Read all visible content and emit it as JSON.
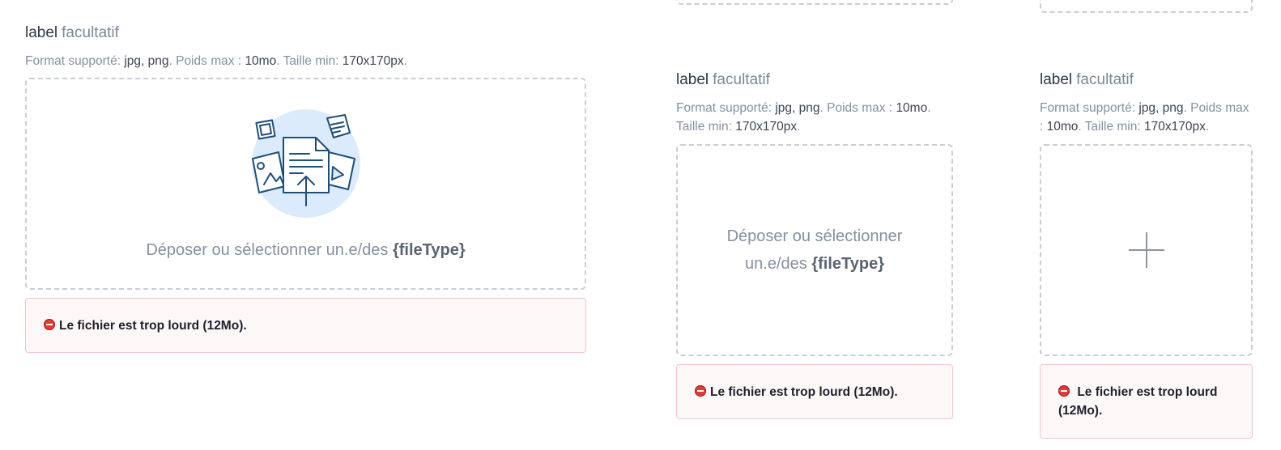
{
  "field_a": {
    "label": "label",
    "optional": "facultatif",
    "hint": {
      "format_label": "Format supporté:",
      "format_value": "jpg, png",
      "weight_label": "Poids max :",
      "weight_value": "10mo",
      "size_label": "Taille min:",
      "size_value": "170x170px"
    },
    "drop_text": "Déposer ou sélectionner un.e/des",
    "drop_type": "{fileType}",
    "error": "Le fichier est trop lourd (12Mo)."
  },
  "field_b": {
    "label": "label",
    "optional": "facultatif",
    "hint": {
      "format_label": "Format supporté:",
      "format_value": "jpg, png",
      "weight_label": "Poids max :",
      "weight_value": "10mo",
      "size_label": "Taille min:",
      "size_value": "170x170px"
    },
    "drop_text": "Déposer ou sélectionner un.e/des",
    "drop_type": "{fileType}",
    "error": "Le fichier est trop lourd (12Mo)."
  },
  "field_c": {
    "label": "label",
    "optional": "facultatif",
    "hint": {
      "format_label": "Format supporté:",
      "format_value": "jpg, png",
      "weight_label": "Poids max :",
      "weight_value": "10mo",
      "size_label": "Taille min:",
      "size_value": "170x170px"
    },
    "error": "Le fichier est trop lourd (12Mo)."
  },
  "colors": {
    "accent": "#1f4e79",
    "illustration_bg": "#dcebfb",
    "error_border": "#f3c4c8",
    "error_icon": "#e23a3a",
    "dashed_border": "#c9cdd4"
  },
  "icons": {
    "upload": "upload-illustration-icon",
    "plus": "plus-icon",
    "error": "no-entry-icon"
  }
}
